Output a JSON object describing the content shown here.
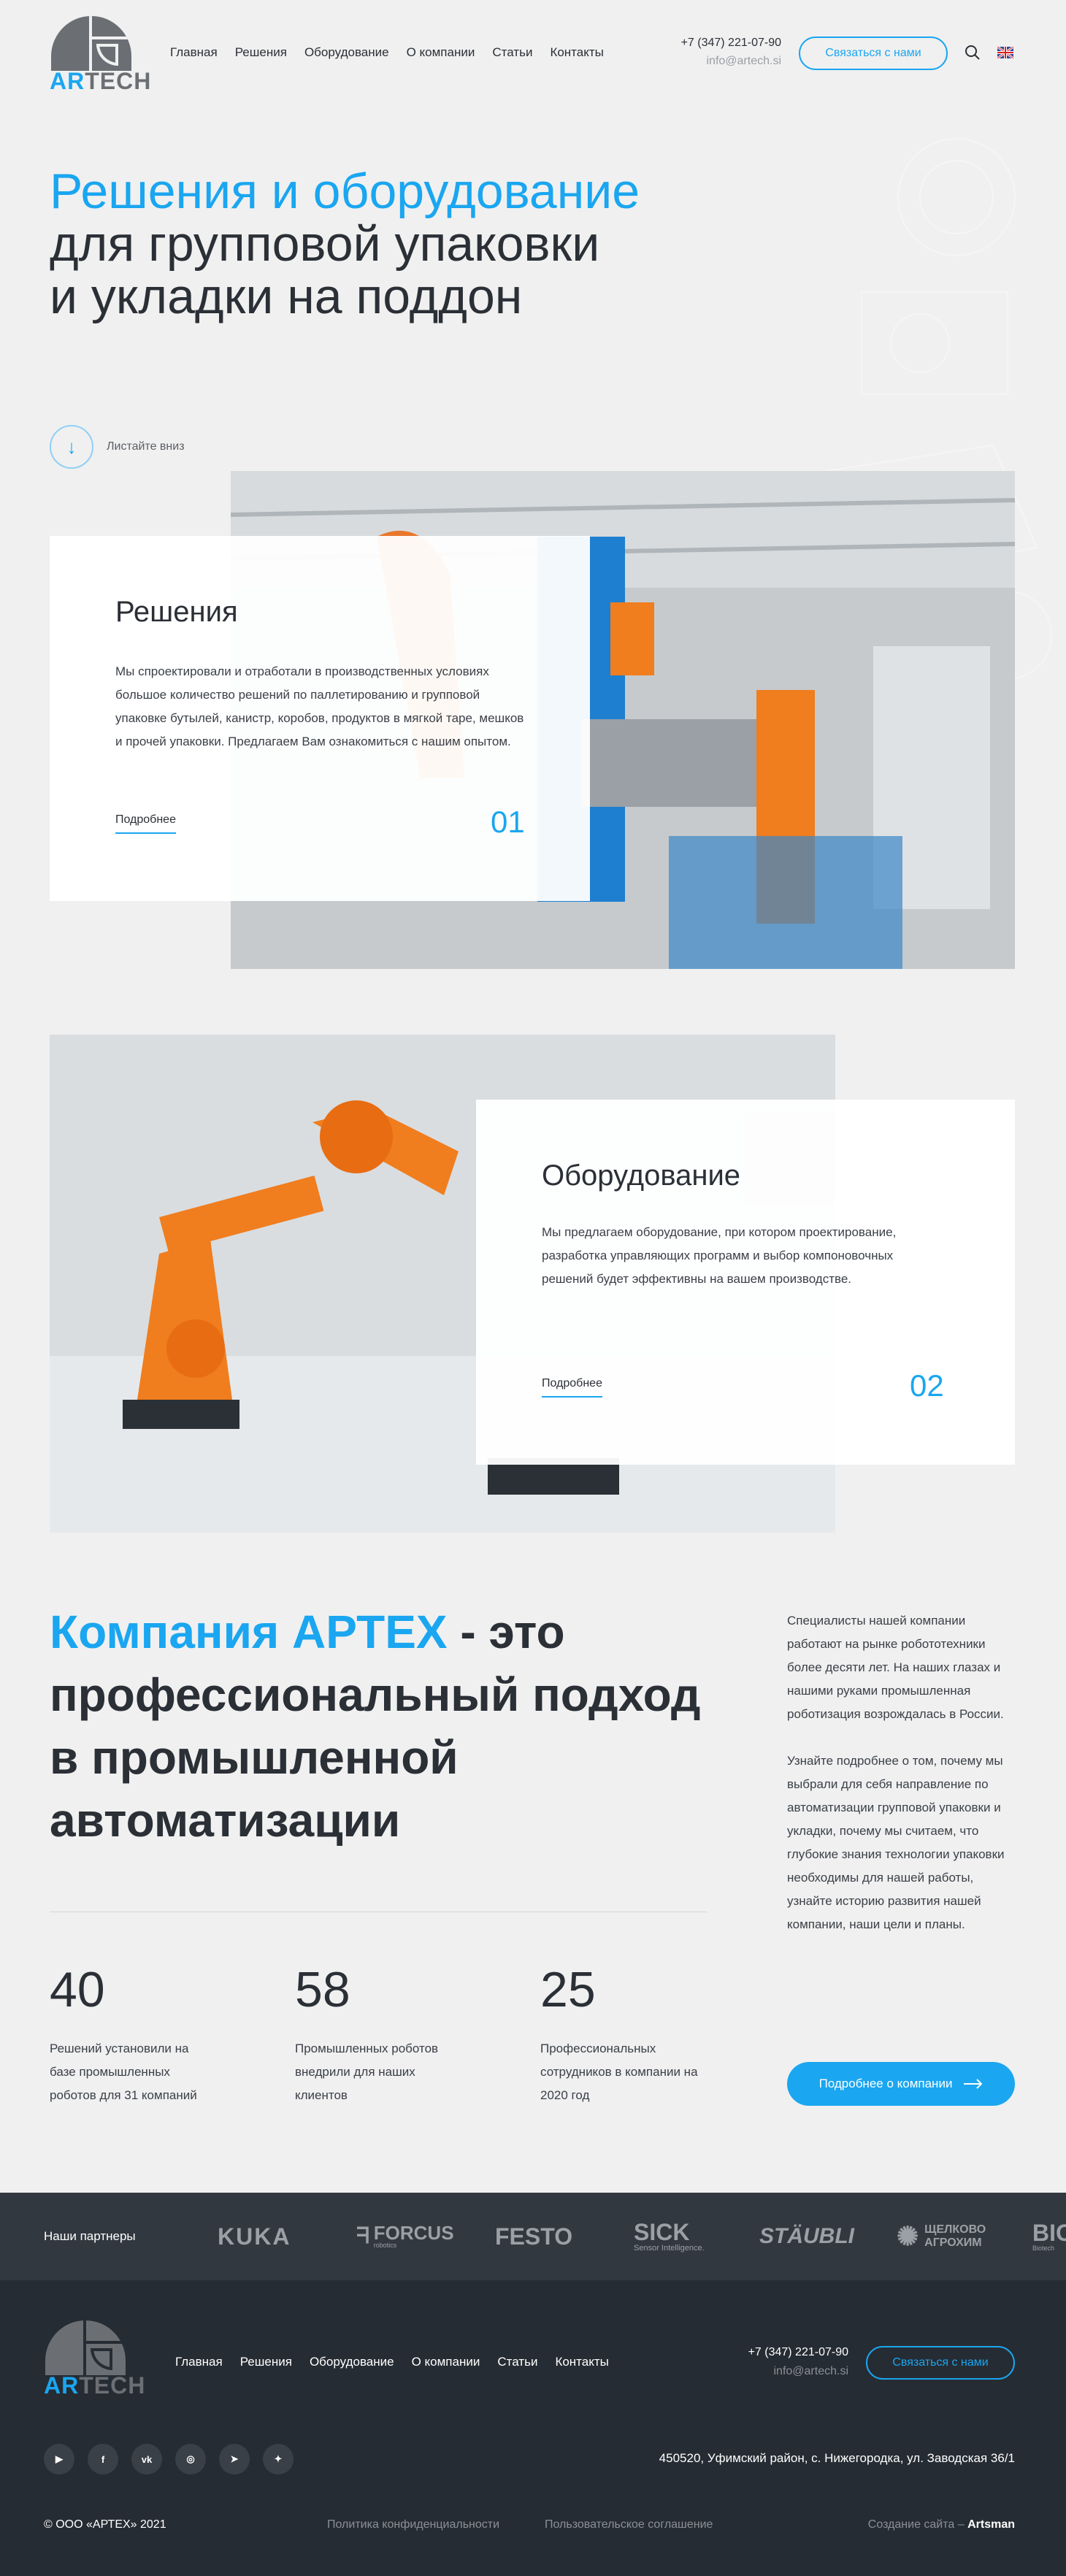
{
  "header": {
    "logo_word_a": "AR",
    "logo_word_b": "TECH",
    "nav": [
      "Главная",
      "Решения",
      "Оборудование",
      "О компании",
      "Статьи",
      "Контакты"
    ],
    "phone": "+7 (347) 221-07-90",
    "email": "info@artech.si",
    "contact_button": "Связаться с нами"
  },
  "hero": {
    "title_line1": "Решения и оборудование",
    "title_line2": "для групповой упаковки",
    "title_line3": "и укладки на поддон",
    "scroll_label": "Листайте вниз"
  },
  "solutions": {
    "title": "Решения",
    "text": "Мы спроектировали и отработали в производственных условиях большое количество решений по паллетированию и групповой упаковке бутылей, канистр, коробов, продуктов в мягкой таре, мешков и прочей упаковки. Предлагаем Вам ознакомиться с нашим опытом.",
    "link": "Подробнее",
    "number": "01"
  },
  "equipment": {
    "title": "Оборудование",
    "text": "Мы предлагаем оборудование, при котором проектирование, разработка управляющих программ и выбор компоновочных решений будет эффективны на вашем производстве.",
    "link": "Подробнее",
    "number": "02"
  },
  "about": {
    "title_highlight": "Компания АРТЕХ",
    "title_rest": " - это профессиональный подход в промышленной автоматизации",
    "stats": [
      {
        "value": "40",
        "text": "Решений установили на базе промышленных роботов для 31 компаний"
      },
      {
        "value": "58",
        "text": "Промышленных роботов внедрили для наших клиентов"
      },
      {
        "value": "25",
        "text": "Профессиональных сотрудников в компании на 2020 год"
      }
    ],
    "side_p1": "Специалисты нашей компании работают на рынке робототехники более десяти лет. На наших глазах и нашими руками промышленная роботизация возрождалась в России.",
    "side_p2": "Узнайте подробнее о том, почему мы выбрали для себя направление по автоматизации групповой упаковки и укладки, почему мы считаем, что глубокие знания технологии упаковки необходимы для нашей работы, узнайте историю развития нашей компании, наши цели и планы.",
    "button": "Подробнее о компании"
  },
  "partners": {
    "label": "Наши партнеры",
    "logos": [
      "KUKA",
      "FORCUS",
      "FESTO",
      "SICK",
      "STÄUBLI",
      "ЩЕЛКОВО АГРОХИМ",
      "BIO"
    ],
    "sick_sub": "Sensor Intelligence.",
    "forcus_sub": "robotics",
    "bio_sub": "Biotech"
  },
  "footer": {
    "nav": [
      "Главная",
      "Решения",
      "Оборудование",
      "О компании",
      "Статьи",
      "Контакты"
    ],
    "phone": "+7 (347) 221-07-90",
    "email": "info@artech.si",
    "contact_button": "Связаться с нами",
    "address": "450520, Уфимский район, с. Нижегородка, ул. Заводская 36/1",
    "copyright": "© ООО «АРТЕХ» 2021",
    "privacy": "Политика конфиденциальности",
    "agreement": "Пользовательское соглашение",
    "made_by_label": "Создание сайта –",
    "made_by_name": "Artsman"
  },
  "icons": {
    "search": "search-icon",
    "flag": "uk-flag-icon",
    "scroll": "arrow-down-icon",
    "socials": [
      "youtube-icon",
      "facebook-icon",
      "vk-icon",
      "instagram-icon",
      "telegram-icon",
      "twitter-icon"
    ]
  },
  "colors": {
    "accent": "#1aa6f0",
    "dark": "#2b2f36",
    "footer_bg": "#262c33",
    "partners_bg": "#32383f"
  }
}
